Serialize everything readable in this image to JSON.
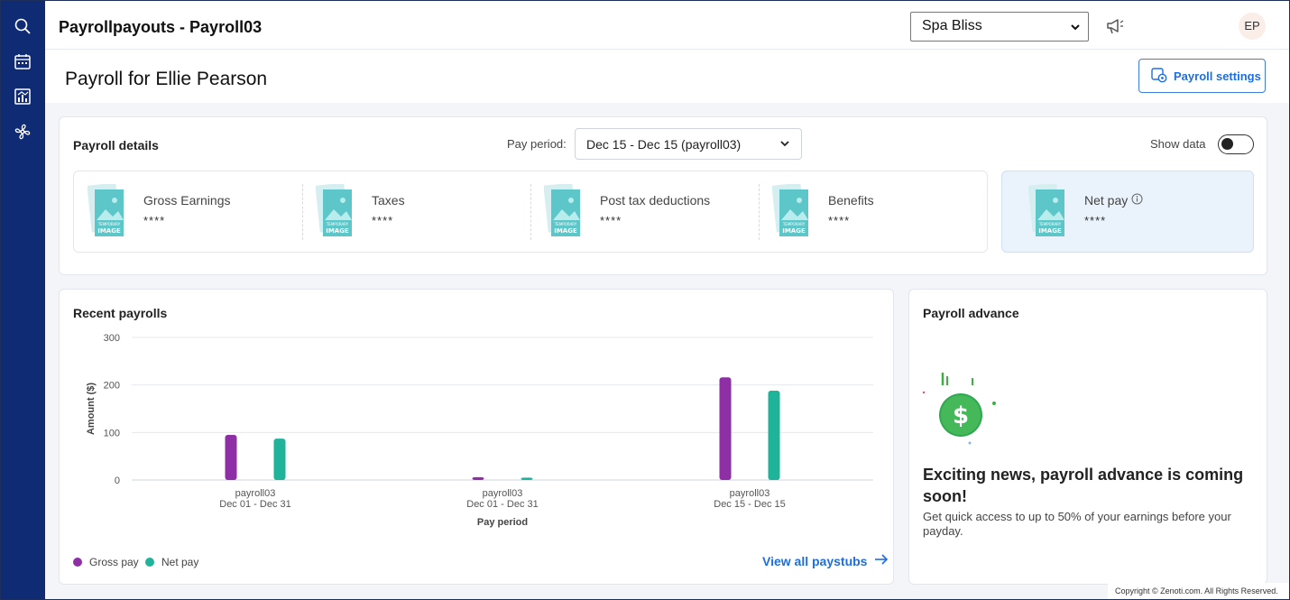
{
  "sidebar": {
    "icons": [
      "search-icon",
      "calendar-icon",
      "reports-icon",
      "fan-icon"
    ]
  },
  "topbar": {
    "title": "Payrollpayouts - Payroll03",
    "org_select_value": "Spa Bliss",
    "avatar_initials": "EP"
  },
  "header": {
    "title": "Payroll for Ellie Pearson",
    "settings_button": "Payroll settings"
  },
  "details": {
    "title": "Payroll details",
    "pay_period_label": "Pay period:",
    "pay_period_value": "Dec 15 - Dec 15 (payroll03)",
    "show_data_label": "Show data",
    "show_data_on": false,
    "thumbnail_text": [
      "TEMPORARY",
      "IMAGE"
    ],
    "metrics": [
      {
        "label": "Gross Earnings",
        "value": "****"
      },
      {
        "label": "Taxes",
        "value": "****"
      },
      {
        "label": "Post tax deductions",
        "value": "****"
      },
      {
        "label": "Benefits",
        "value": "****"
      }
    ],
    "net_pay": {
      "label": "Net pay",
      "value": "****"
    }
  },
  "recent": {
    "title": "Recent payrolls",
    "view_all": "View all paystubs"
  },
  "chart_data": {
    "type": "bar",
    "title": "",
    "xlabel": "Pay period",
    "ylabel": "Amount ($)",
    "ylim": [
      0,
      300
    ],
    "yticks": [
      0,
      100,
      200,
      300
    ],
    "grid": true,
    "legend_position": "bottom-left",
    "categories": [
      {
        "name": "payroll03",
        "range": "Dec 01 - Dec 31"
      },
      {
        "name": "payroll03",
        "range": "Dec 01 - Dec 31"
      },
      {
        "name": "payroll03",
        "range": "Dec 15 - Dec 15"
      }
    ],
    "series": [
      {
        "name": "Gross pay",
        "color": "#8e2fa6",
        "values": [
          95,
          6,
          216
        ]
      },
      {
        "name": "Net pay",
        "color": "#1fb39a",
        "values": [
          87,
          5,
          188
        ]
      }
    ]
  },
  "advance": {
    "title": "Payroll advance",
    "heading": "Exciting news, payroll advance is coming soon!",
    "text": "Get quick access to up to 50% of your earnings before your payday.",
    "icon": "dollar-coin-icon"
  },
  "footer": {
    "copyright": "Copyright © Zenoti.com. All Rights Reserved."
  }
}
